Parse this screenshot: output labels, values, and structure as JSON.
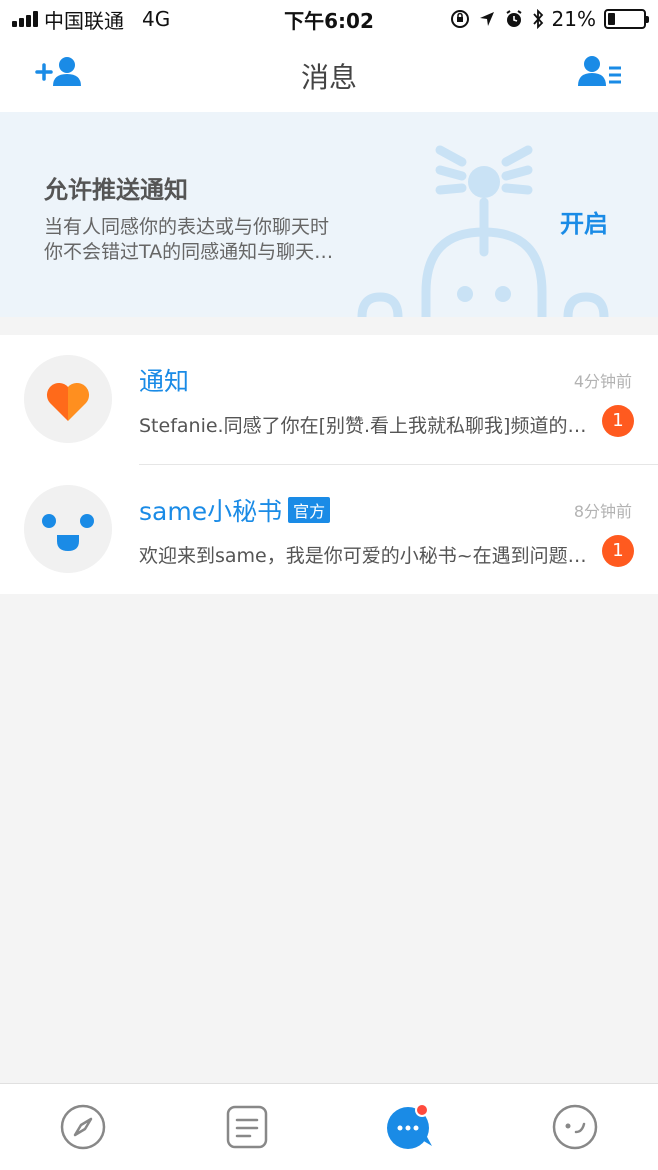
{
  "status_bar": {
    "carrier": "中国联通",
    "network": "4G",
    "time": "下午6:02",
    "battery_percent": "21%",
    "battery_level": 0.21
  },
  "nav": {
    "title": "消息",
    "left_icon": "add-friend-icon",
    "right_icon": "contacts-list-icon"
  },
  "banner": {
    "title": "允许推送通知",
    "line1": "当有人同感你的表达或与你聊天时",
    "line2": "你不会错过TA的同感通知与聊天…",
    "button_label": "开启"
  },
  "messages": [
    {
      "name": "通知",
      "time": "4分钟前",
      "preview": "Stefanie.同感了你在[别赞.看上我就私聊我]频道的内容",
      "unread": "1",
      "icon": "heart-icon"
    },
    {
      "name": "same小秘书",
      "badge": "官方",
      "time": "8分钟前",
      "preview": "欢迎来到same，我是你可爱的小秘书~在遇到问题时可以找我哦",
      "unread": "1",
      "icon": "smiley-face-icon"
    }
  ],
  "tabs": [
    {
      "icon": "compass-icon"
    },
    {
      "icon": "document-list-icon"
    },
    {
      "icon": "chat-bubble-icon",
      "active": true
    },
    {
      "icon": "profile-face-icon"
    }
  ],
  "colors": {
    "accent": "#1a8be6",
    "badge": "#ff5a1f",
    "banner_bg": "#edf4fa",
    "page_bg": "#f4f4f4"
  }
}
